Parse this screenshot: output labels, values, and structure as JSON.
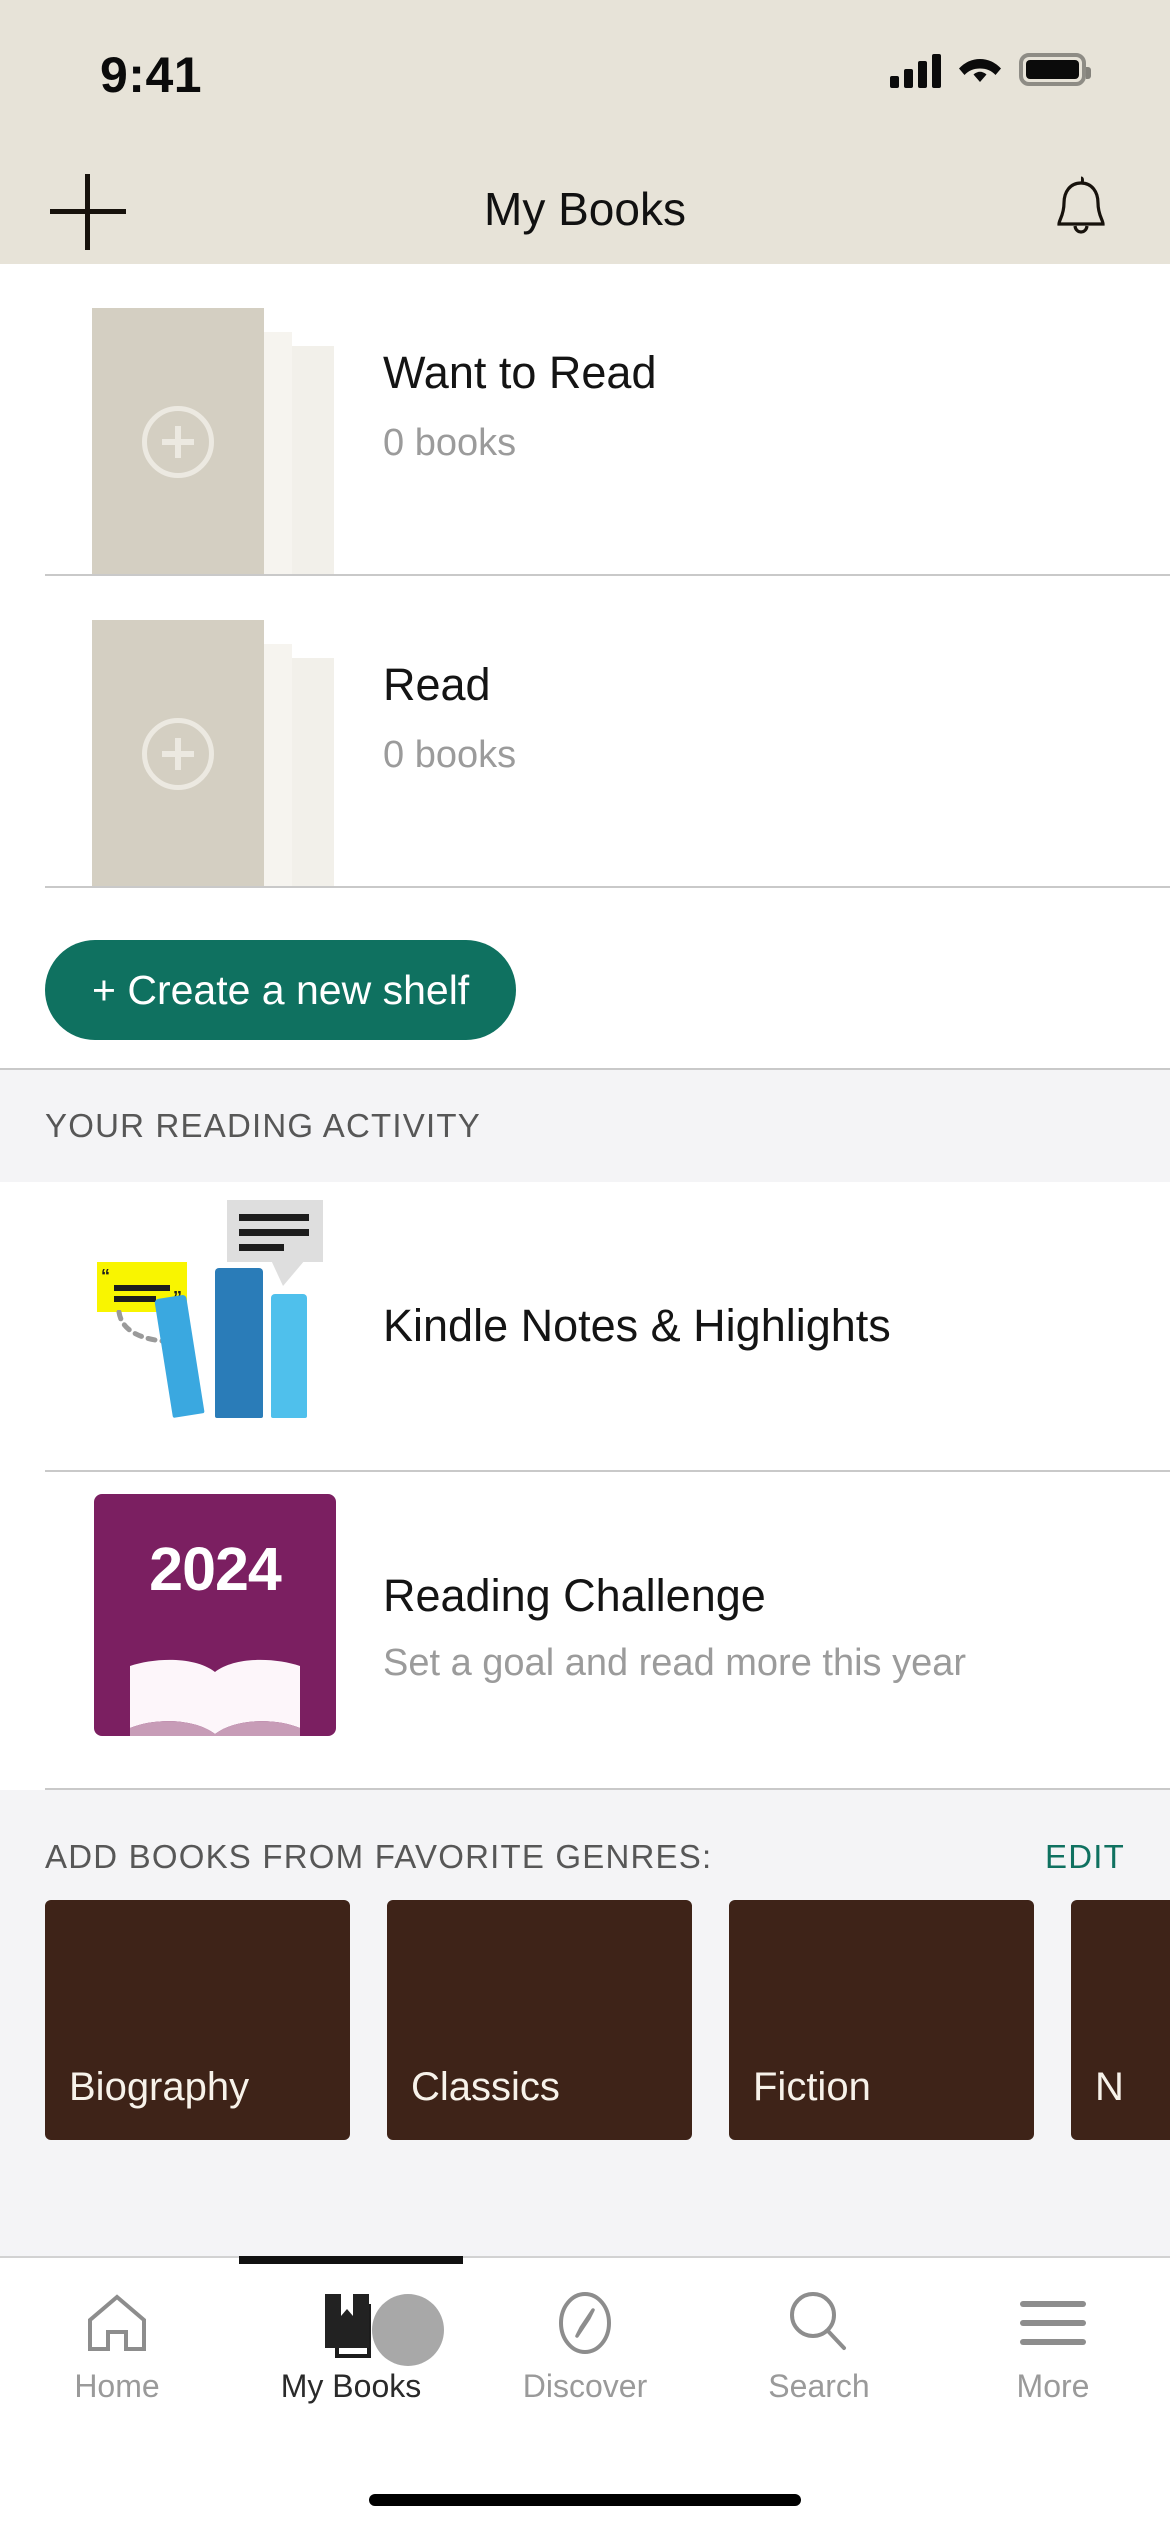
{
  "status_bar": {
    "time": "9:41",
    "signal_icon": "cellular-signal-icon",
    "wifi_icon": "wifi-icon",
    "battery_icon": "battery-icon"
  },
  "nav": {
    "title": "My Books",
    "add_icon": "plus-icon",
    "notifications_icon": "bell-icon"
  },
  "shelves": [
    {
      "name": "Want to Read",
      "count": "0 books",
      "cover_icon": "add-book-circle-plus-icon"
    },
    {
      "name": "Read",
      "count": "0 books",
      "cover_icon": "add-book-circle-plus-icon"
    }
  ],
  "create_shelf": {
    "label": "+ Create a new shelf",
    "color": "#0f7160"
  },
  "reading_activity": {
    "section_title": "YOUR READING ACTIVITY",
    "items": [
      {
        "title": "Kindle Notes & Highlights",
        "subtitle": "",
        "art": "kindle-notes-illustration"
      },
      {
        "title": "Reading Challenge",
        "subtitle": "Set a goal and read more this year",
        "art": "reading-challenge-badge",
        "year": "2024",
        "badge_color": "#7b1f61"
      }
    ]
  },
  "genres": {
    "header": "ADD BOOKS FROM FAVORITE GENRES:",
    "edit_label": "EDIT",
    "edit_color": "#0f7160",
    "card_color": "#3e2318",
    "cards": [
      {
        "label": "Biography"
      },
      {
        "label": "Classics"
      },
      {
        "label": "Fiction"
      },
      {
        "label": "N"
      }
    ]
  },
  "tabbar": {
    "items": [
      {
        "label": "Home",
        "icon": "home-icon",
        "active": false
      },
      {
        "label": "My Books",
        "icon": "books-icon",
        "active": true
      },
      {
        "label": "Discover",
        "icon": "compass-icon",
        "active": false
      },
      {
        "label": "Search",
        "icon": "magnifier-icon",
        "active": false
      },
      {
        "label": "More",
        "icon": "hamburger-menu-icon",
        "active": false
      }
    ]
  }
}
